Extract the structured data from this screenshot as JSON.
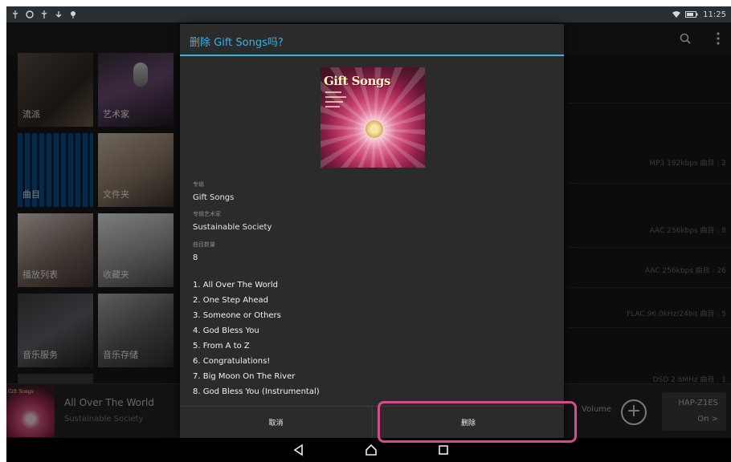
{
  "status_bar": {
    "time": "11:25"
  },
  "tiles": [
    {
      "label": "流派"
    },
    {
      "label": "艺术家"
    },
    {
      "label": "曲目"
    },
    {
      "label": "文件夹"
    },
    {
      "label": "播放列表"
    },
    {
      "label": "收藏夹"
    },
    {
      "label": "音乐服务"
    },
    {
      "label": "音乐存储"
    }
  ],
  "right_list": [
    "MP3 192kbps 曲目 : 2",
    "AAC 256kbps 曲目 : 8",
    "AAC 256kbps 曲目 : 26",
    "FLAC 96.0kHz/24bit 曲目 : 5",
    "DSD 2.8MHz 曲目 : 1"
  ],
  "player": {
    "art_title": "Gift Songs",
    "song_title": "All Over The World",
    "artist": "Sustainable Society",
    "volume_label": "Volume",
    "plus_label": "+",
    "device_name": "HAP-Z1ES",
    "device_sub": "On >"
  },
  "dialog": {
    "title": "删除 Gift Songs吗?",
    "cover_title": "Gift Songs",
    "album_label": "专辑",
    "album_value": "Gift Songs",
    "artist_label": "专辑艺术家",
    "artist_value": "Sustainable Society",
    "count_label": "曲目数量",
    "count_value": "8",
    "tracks": [
      "1. All Over The World",
      "2. One Step Ahead",
      "3. Someone or Others",
      "4. God Bless You",
      "5. From A to Z",
      "6. Congratulations!",
      "7. Big Moon On The River",
      "8. God Bless You (Instrumental)"
    ],
    "cancel_label": "取消",
    "delete_label": "删除"
  },
  "colors": {
    "accent": "#33b5e5",
    "highlight": "#d24d8c"
  }
}
